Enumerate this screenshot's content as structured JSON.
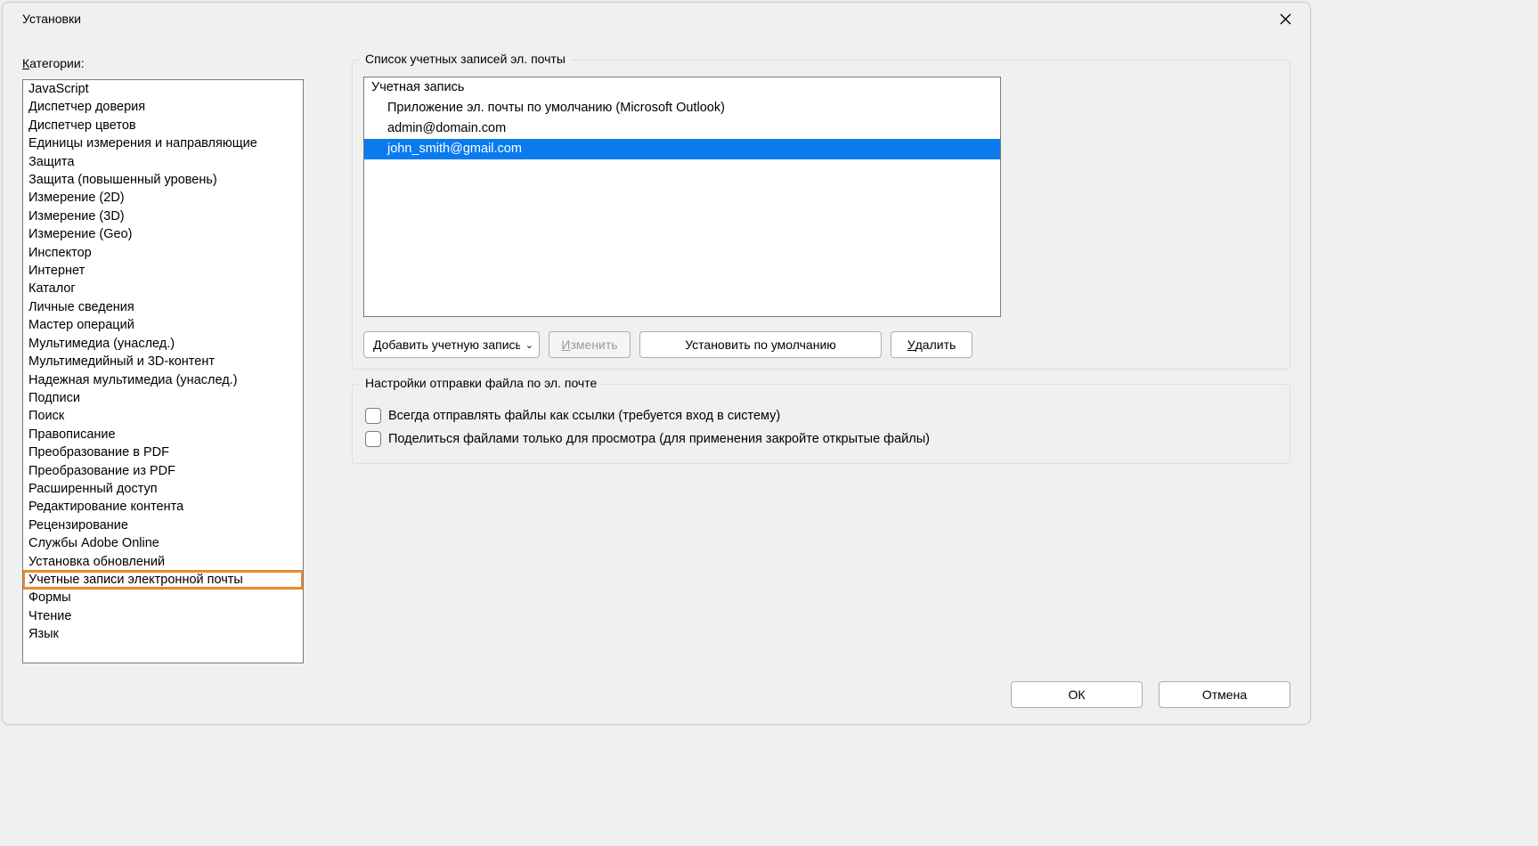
{
  "window": {
    "title": "Установки"
  },
  "categories": {
    "label_prefix": "К",
    "label_rest": "атегории:",
    "items": [
      "JavaScript",
      "Диспетчер доверия",
      "Диспетчер цветов",
      "Единицы измерения и направляющие",
      "Защита",
      "Защита (повышенный уровень)",
      "Измерение (2D)",
      "Измерение (3D)",
      "Измерение (Geo)",
      "Инспектор",
      "Интернет",
      "Каталог",
      "Личные сведения",
      "Мастер операций",
      "Мультимедиа (унаслед.)",
      "Мультимедийный и 3D-контент",
      "Надежная мультимедиа (унаслед.)",
      "Подписи",
      "Поиск",
      "Правописание",
      "Преобразование в PDF",
      "Преобразование из PDF",
      "Расширенный доступ",
      "Редактирование контента",
      "Рецензирование",
      "Службы Adobe Online",
      "Установка обновлений",
      "Учетные записи электронной почты",
      "Формы",
      "Чтение",
      "Язык"
    ],
    "selected_index": 27
  },
  "accounts_group": {
    "title": "Список учетных записей эл. почты",
    "header": "Учетная запись",
    "rows": [
      "Приложение эл. почты по умолчанию (Microsoft Outlook)",
      "admin@domain.com",
      "john_smith@gmail.com"
    ],
    "selected_row_index": 2,
    "add_combo": "Добавить учетную запись",
    "edit_u": "И",
    "edit_rest": "зменить",
    "default_btn": "Установить по умолчанию",
    "delete_u": "У",
    "delete_rest": "далить"
  },
  "send_group": {
    "title": "Настройки отправки файла по эл. почте",
    "chk1": "Всегда отправлять файлы как ссылки (требуется вход в систему)",
    "chk2": "Поделиться файлами только для просмотра (для применения закройте открытые файлы)"
  },
  "footer": {
    "ok": "ОК",
    "cancel": "Отмена"
  }
}
